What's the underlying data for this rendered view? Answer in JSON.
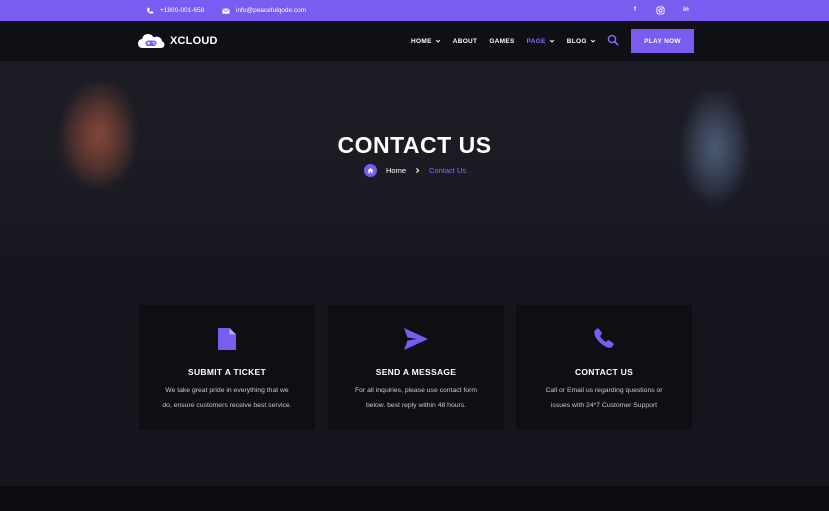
{
  "topbar": {
    "phone": "+1800-001-658",
    "email": "info@peacefulqode.com",
    "social": [
      "f",
      "in"
    ],
    "colors": {
      "background": "#7b5cf0"
    }
  },
  "header": {
    "logo_text": "XCLOUD",
    "nav": [
      {
        "label": "HOME",
        "dropdown": true
      },
      {
        "label": "ABOUT",
        "dropdown": false
      },
      {
        "label": "GAMES",
        "dropdown": false
      },
      {
        "label": "PAGE",
        "dropdown": true,
        "active": true
      },
      {
        "label": "BLOG",
        "dropdown": true
      }
    ],
    "cta_label": "PLAY NOW"
  },
  "hero": {
    "title": "CONTACT US",
    "breadcrumb": {
      "home": "Home",
      "current": "Contact Us"
    }
  },
  "cards": [
    {
      "icon": "document-icon",
      "title": "SUBMIT A TICKET",
      "line1": "We take great pride in everything that we",
      "line2": "do, ensure customers receive best service."
    },
    {
      "icon": "send-icon",
      "title": "SEND A MESSAGE",
      "line1": "For all inquiries, please use contact form",
      "line2": "below. best reply within 48 hours."
    },
    {
      "icon": "phone-icon",
      "title": "CONTACT US",
      "line1": "Call or Email us regarding questions or",
      "line2": "issues with 24*7 Customer Support"
    }
  ],
  "colors": {
    "accent": "#7b5cf0",
    "background": "#16161f",
    "card": "#0e0e13"
  }
}
